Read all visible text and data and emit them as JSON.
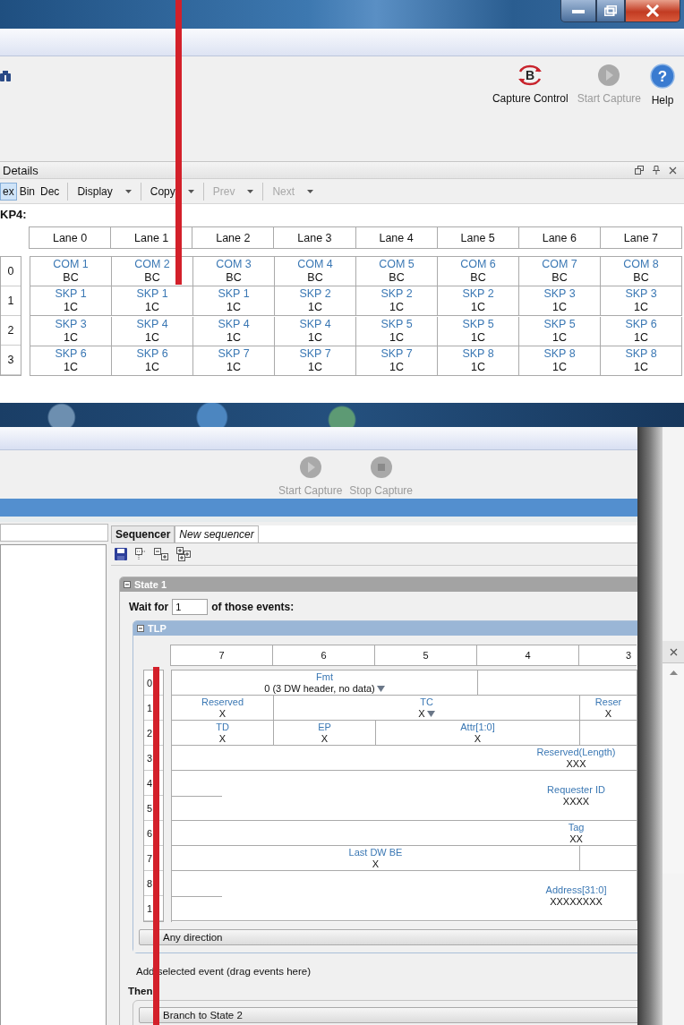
{
  "top_window": {
    "toolbar_buttons": [
      {
        "kind": "capture",
        "icon_text": "B",
        "label": "Capture Control",
        "disabled": false
      },
      {
        "kind": "start",
        "label": "Start Capture",
        "disabled": true
      },
      {
        "kind": "help",
        "icon_text": "?",
        "label": "Help",
        "disabled": false
      }
    ],
    "details": {
      "title": "Details",
      "format_tabs": [
        {
          "label": "ex",
          "selected": true
        },
        {
          "label": "Bin",
          "selected": false
        },
        {
          "label": "Dec",
          "selected": false
        }
      ],
      "menus": [
        {
          "label": "Display",
          "disabled": false
        },
        {
          "label": "Copy",
          "disabled": false
        },
        {
          "label": "Prev",
          "disabled": true
        },
        {
          "label": "Next",
          "disabled": true
        }
      ],
      "heading": "KP4:",
      "lanes": [
        "Lane 0",
        "Lane 1",
        "Lane 2",
        "Lane 3",
        "Lane 4",
        "Lane 5",
        "Lane 6",
        "Lane 7"
      ],
      "rows": [
        {
          "label": "0",
          "cells": [
            {
              "symbol": "COM 1",
              "value": "BC"
            },
            {
              "symbol": "COM 2",
              "value": "BC"
            },
            {
              "symbol": "COM 3",
              "value": "BC"
            },
            {
              "symbol": "COM 4",
              "value": "BC"
            },
            {
              "symbol": "COM 5",
              "value": "BC"
            },
            {
              "symbol": "COM 6",
              "value": "BC"
            },
            {
              "symbol": "COM 7",
              "value": "BC"
            },
            {
              "symbol": "COM 8",
              "value": "BC"
            }
          ]
        },
        {
          "label": "1",
          "cells": [
            {
              "symbol": "SKP 1",
              "value": "1C"
            },
            {
              "symbol": "SKP 1",
              "value": "1C"
            },
            {
              "symbol": "SKP 1",
              "value": "1C"
            },
            {
              "symbol": "SKP 2",
              "value": "1C"
            },
            {
              "symbol": "SKP 2",
              "value": "1C"
            },
            {
              "symbol": "SKP 2",
              "value": "1C"
            },
            {
              "symbol": "SKP 3",
              "value": "1C"
            },
            {
              "symbol": "SKP 3",
              "value": "1C"
            }
          ]
        },
        {
          "label": "2",
          "cells": [
            {
              "symbol": "SKP 3",
              "value": "1C"
            },
            {
              "symbol": "SKP 4",
              "value": "1C"
            },
            {
              "symbol": "SKP 4",
              "value": "1C"
            },
            {
              "symbol": "SKP 4",
              "value": "1C"
            },
            {
              "symbol": "SKP 5",
              "value": "1C"
            },
            {
              "symbol": "SKP 5",
              "value": "1C"
            },
            {
              "symbol": "SKP 5",
              "value": "1C"
            },
            {
              "symbol": "SKP 6",
              "value": "1C"
            }
          ]
        },
        {
          "label": "3",
          "cells": [
            {
              "symbol": "SKP 6",
              "value": "1C"
            },
            {
              "symbol": "SKP 6",
              "value": "1C"
            },
            {
              "symbol": "SKP 7",
              "value": "1C"
            },
            {
              "symbol": "SKP 7",
              "value": "1C"
            },
            {
              "symbol": "SKP 7",
              "value": "1C"
            },
            {
              "symbol": "SKP 8",
              "value": "1C"
            },
            {
              "symbol": "SKP 8",
              "value": "1C"
            },
            {
              "symbol": "SKP 8",
              "value": "1C"
            }
          ]
        }
      ]
    }
  },
  "bottom_window": {
    "toolbar_buttons": [
      {
        "kind": "start",
        "label": "Start Capture",
        "disabled": true
      },
      {
        "kind": "stop",
        "label": "Stop Capture",
        "disabled": true
      }
    ],
    "tabs": [
      {
        "label": "Sequencer",
        "selected": true
      },
      {
        "label": "New sequencer",
        "selected": false
      }
    ],
    "state": {
      "title": "State 1",
      "wait_label": "Wait for",
      "wait_value": "1",
      "wait_suffix": "of those events:",
      "event": {
        "title": "TLP",
        "bit_columns": [
          "7",
          "6",
          "5",
          "4",
          "3"
        ],
        "row_labels": [
          "0",
          "1",
          "2",
          "3",
          "4",
          "5",
          "6",
          "7",
          "8",
          "1"
        ],
        "fields": [
          {
            "name": "Fmt",
            "value": "0 (3 DW header, no data)",
            "dropdown": true
          },
          {
            "name": "Reserved",
            "value": "X",
            "dropdown": false
          },
          {
            "name": "TC",
            "value": "X",
            "dropdown": true
          },
          {
            "name": "Reser",
            "value": "X",
            "dropdown": false
          },
          {
            "name": "TD",
            "value": "X",
            "dropdown": false
          },
          {
            "name": "EP",
            "value": "X",
            "dropdown": false
          },
          {
            "name": "Attr[1:0]",
            "value": "X",
            "dropdown": false
          },
          {
            "name": "Reserved(Length)",
            "value": "XXX",
            "dropdown": false
          },
          {
            "name": "Requester ID",
            "value": "XXXX",
            "dropdown": false
          },
          {
            "name": "Tag",
            "value": "XX",
            "dropdown": false
          },
          {
            "name": "Last DW BE",
            "value": "X",
            "dropdown": false
          },
          {
            "name": "Address[31:0]",
            "value": "XXXXXXXX",
            "dropdown": false
          }
        ],
        "direction": "Any direction"
      },
      "add_hint": "Add selected event (drag events here)",
      "then_label": "Then",
      "action": "Branch to State 2"
    }
  }
}
